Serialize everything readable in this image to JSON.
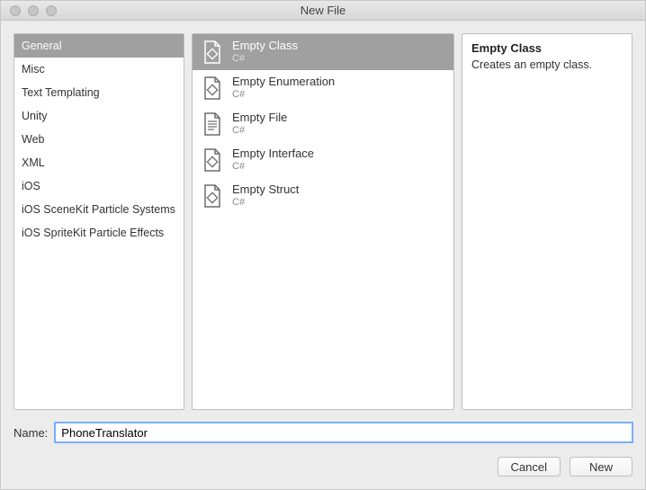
{
  "window": {
    "title": "New File"
  },
  "categories": [
    {
      "label": "General",
      "selected": true
    },
    {
      "label": "Misc"
    },
    {
      "label": "Text Templating"
    },
    {
      "label": "Unity"
    },
    {
      "label": "Web"
    },
    {
      "label": "XML"
    },
    {
      "label": "iOS"
    },
    {
      "label": "iOS SceneKit Particle Systems"
    },
    {
      "label": "iOS SpriteKit Particle Effects"
    }
  ],
  "templates": [
    {
      "label": "Empty Class",
      "lang": "C#",
      "selected": true,
      "icon": "code"
    },
    {
      "label": "Empty Enumeration",
      "lang": "C#",
      "icon": "code"
    },
    {
      "label": "Empty File",
      "lang": "C#",
      "icon": "text"
    },
    {
      "label": "Empty Interface",
      "lang": "C#",
      "icon": "code"
    },
    {
      "label": "Empty Struct",
      "lang": "C#",
      "icon": "code"
    }
  ],
  "description": {
    "title": "Empty Class",
    "body": "Creates an empty class."
  },
  "name": {
    "label": "Name:",
    "value": "PhoneTranslator"
  },
  "buttons": {
    "cancel": "Cancel",
    "new": "New"
  }
}
